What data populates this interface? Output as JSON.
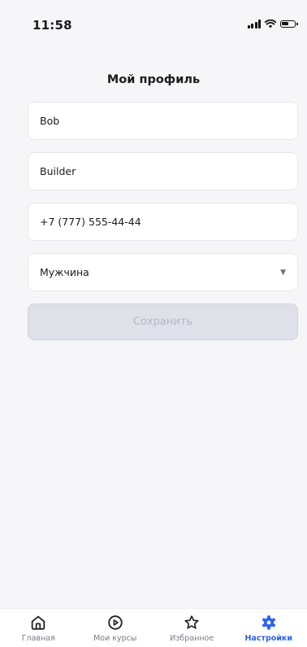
{
  "status_bar": {
    "time": "11:58"
  },
  "page": {
    "title": "Мой профиль"
  },
  "form": {
    "first_name": "Bob",
    "last_name": "Builder",
    "phone": "+7 (777) 555-44-44",
    "gender": "Мужчина",
    "save_label": "Сохранить"
  },
  "tabbar": {
    "active_color": "#2d62ee",
    "items": [
      {
        "label": "Главная",
        "icon": "home-icon"
      },
      {
        "label": "Мои курсы",
        "icon": "play-circle-icon"
      },
      {
        "label": "Избранное",
        "icon": "star-icon"
      },
      {
        "label": "Настройки",
        "icon": "gear-icon",
        "active": true
      }
    ]
  }
}
